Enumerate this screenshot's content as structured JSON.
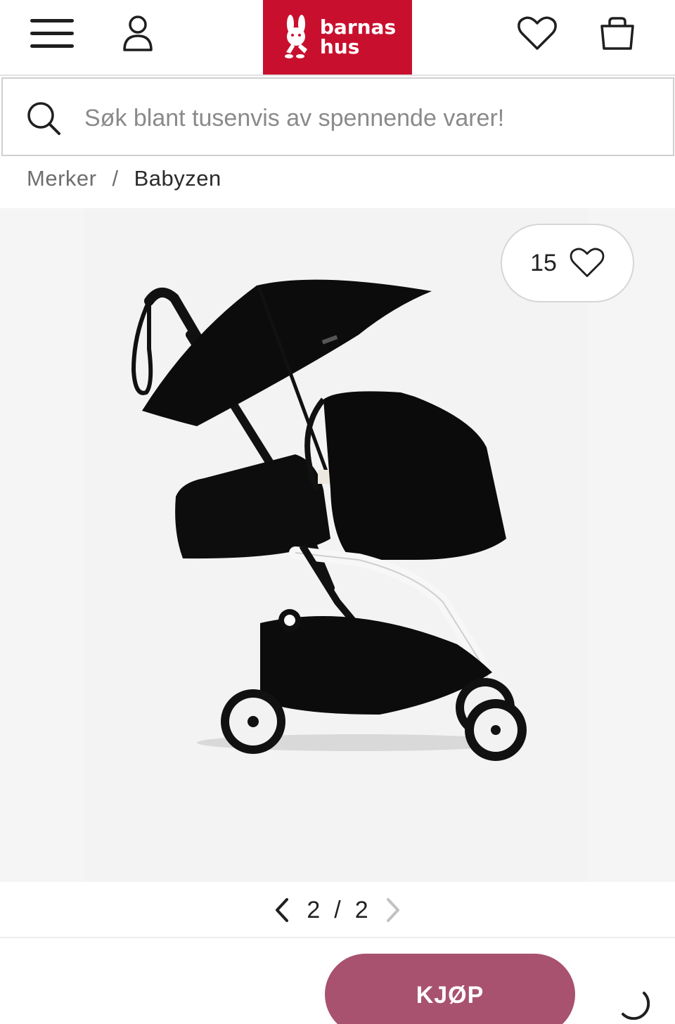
{
  "header": {
    "logo_line1": "barnas",
    "logo_line2": "hus",
    "brand_color": "#c8102e",
    "icons": [
      "menu-icon",
      "user-icon",
      "heart-icon",
      "shopping-bag-icon"
    ]
  },
  "search": {
    "placeholder": "Søk blant tusenvis av spennende varer!",
    "value": ""
  },
  "breadcrumb": {
    "items": [
      {
        "label": "Merker"
      },
      {
        "label": "Babyzen"
      }
    ],
    "separator": "/"
  },
  "gallery": {
    "favorite_count": "15",
    "current_page": "2",
    "separator": "/",
    "total_pages": "2"
  },
  "actions": {
    "buy_label": "KJØP",
    "buy_color": "#a8526f"
  }
}
